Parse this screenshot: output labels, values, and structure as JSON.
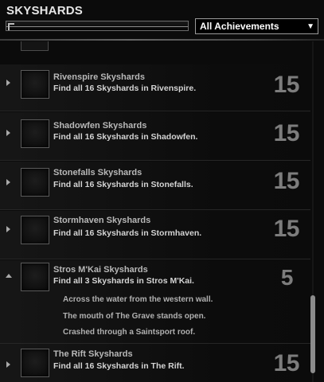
{
  "header": {
    "title": "SKYSHARDS",
    "filter": {
      "selected": "All Achievements",
      "caret": "▼"
    }
  },
  "achievements": [
    {
      "title": "Rivenspire Skyshards",
      "description": "Find all 16 Skyshards in Rivenspire.",
      "points": "15",
      "expanded": false
    },
    {
      "title": "Shadowfen Skyshards",
      "description": "Find all 16 Skyshards in Shadowfen.",
      "points": "15",
      "expanded": false
    },
    {
      "title": "Stonefalls Skyshards",
      "description": "Find all 16 Skyshards in Stonefalls.",
      "points": "15",
      "expanded": false
    },
    {
      "title": "Stormhaven Skyshards",
      "description": "Find all 16 Skyshards in Stormhaven.",
      "points": "15",
      "expanded": false
    },
    {
      "title": "Stros M'Kai Skyshards",
      "description": "Find all 3 Skyshards in Stros M'Kai.",
      "points": "5",
      "expanded": true,
      "criteria": [
        "Across the water from the western wall.",
        "The mouth of The Grave stands open.",
        "Crashed through a Saintsport roof."
      ]
    },
    {
      "title": "The Rift Skyshards",
      "description": "Find all 16 Skyshards in The Rift.",
      "points": "15",
      "expanded": false
    }
  ],
  "colors": {
    "background": "#0b0b0b",
    "title": "#e6e6e6",
    "points": "#7d7d7d",
    "scrollbar": "#8c8c8c"
  },
  "icons": {
    "row_collapsed": "triangle-right-icon",
    "row_expanded": "triangle-up-icon",
    "achievement": "achievement-icon-frame"
  }
}
